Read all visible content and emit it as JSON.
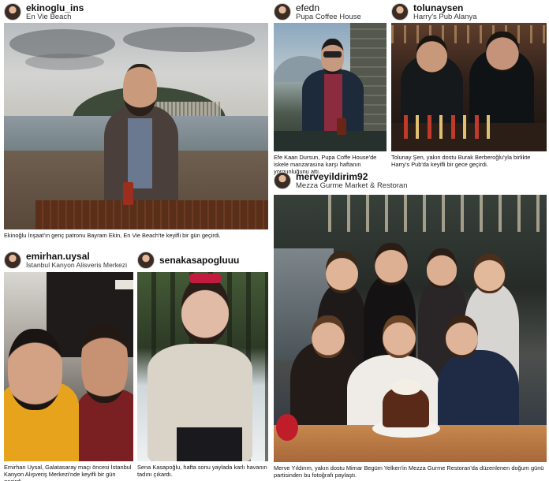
{
  "posts": [
    {
      "username": "ekinoglu_ins",
      "location": "En Vie Beach",
      "caption": "Ekinoğlu İnşaat'ın genç patronu Bayram Ekin, En Vie Beach'te keyifli bir gün geçirdi."
    },
    {
      "username": "efedn",
      "location": "Pupa Coffee House",
      "caption": "Efe Kaan Dursun, Pupa Coffe House'de iskele manzarasına karşı haftanın yorgunluğunu attı."
    },
    {
      "username": "tolunaysen",
      "location": "Harry's Pub Alanya",
      "caption": "Tolunay Şen, yakın dostu Burak Berberoğlu'yla birlikte Harry's Pub'da keyifli bir gece geçirdi."
    },
    {
      "username": "merveyildirim92",
      "location": "Mezza Gurme Market & Restoran",
      "caption": "Merve Yıldırım, yakın dostu Mimar Begüm Yelken'in Mezza Gurme Restoran'da düzenlenen doğum günü partisinden bu fotoğrafı paylaştı."
    },
    {
      "username": "emirhan.uysal",
      "location": "İstanbul Kanyon Alisveris Merkezi",
      "caption": "Emirhan Uysal, Galatasaray maçı öncesi İstanbul Kanyon Alışveriş Merkezi'nde keyifli bir gün geçirdi."
    },
    {
      "username": "senakasapogluuu",
      "location": "",
      "caption": "Sena Kasapoğlu, hafta sonu yaylada karlı havanın tadını çıkardı."
    }
  ]
}
